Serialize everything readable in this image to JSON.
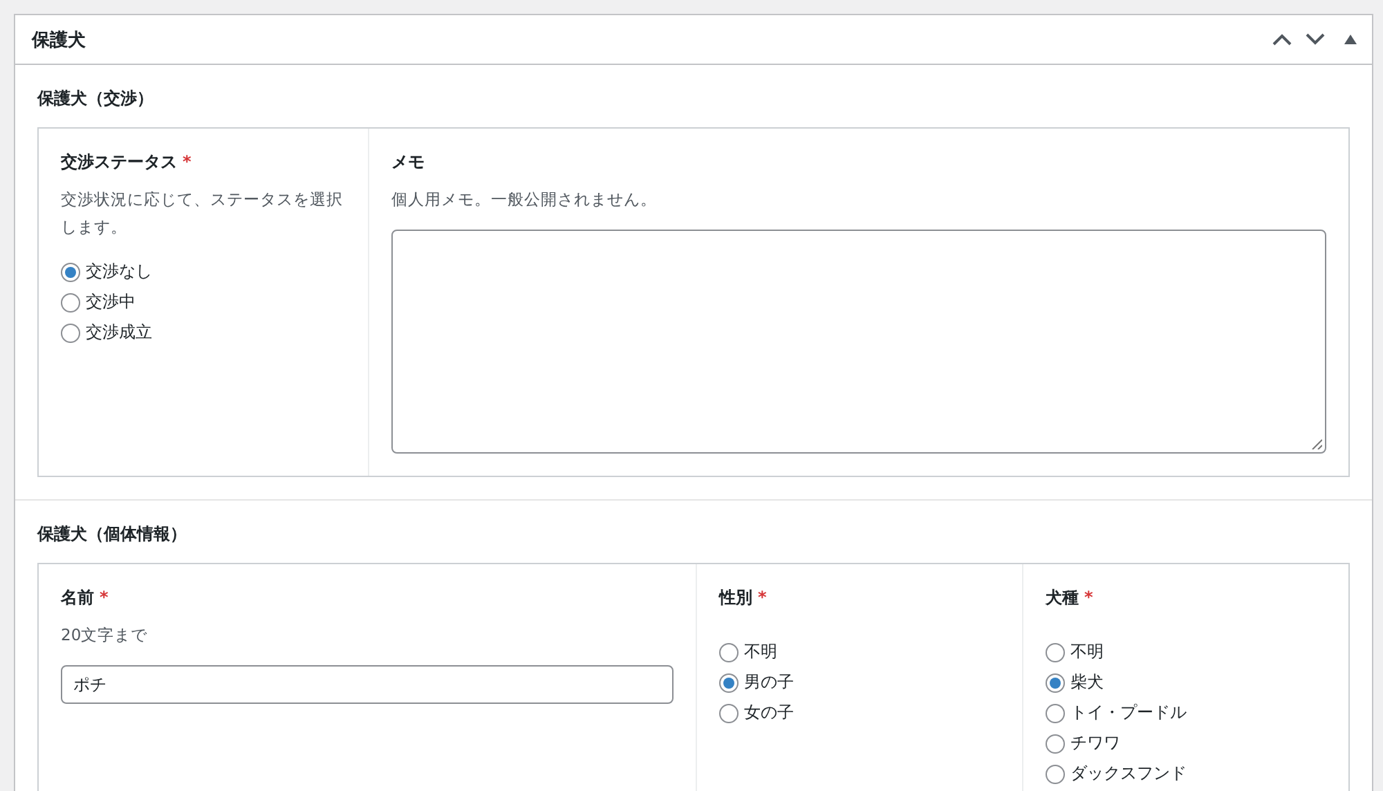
{
  "panel": {
    "title": "保護犬",
    "controls": [
      {
        "kind": "up"
      },
      {
        "kind": "down"
      },
      {
        "kind": "toggle"
      }
    ]
  },
  "sections": [
    {
      "title": "保護犬（交渉）",
      "fields": [
        {
          "kind": "radio",
          "label": "交渉ステータス",
          "required_mark": "*",
          "description": "交渉状況に応じて、ステータスを選択します。",
          "options": [
            {
              "label": "交渉なし",
              "selected": true
            },
            {
              "label": "交渉中",
              "selected": false
            },
            {
              "label": "交渉成立",
              "selected": false
            }
          ]
        },
        {
          "kind": "textarea",
          "label": "メモ",
          "description": "個人用メモ。一般公開されません。"
        }
      ]
    },
    {
      "title": "保護犬（個体情報）",
      "fields": [
        {
          "kind": "text",
          "label": "名前",
          "required_mark": "*",
          "description": "20文字まで",
          "value": "ポチ"
        },
        {
          "kind": "radio",
          "label": "性別",
          "required_mark": "*",
          "options": [
            {
              "label": "不明",
              "selected": false
            },
            {
              "label": "男の子",
              "selected": true
            },
            {
              "label": "女の子",
              "selected": false
            }
          ]
        },
        {
          "kind": "radio",
          "label": "犬種",
          "required_mark": "*",
          "options": [
            {
              "label": "不明",
              "selected": false
            },
            {
              "label": "柴犬",
              "selected": true
            },
            {
              "label": "トイ・プードル",
              "selected": false
            },
            {
              "label": "チワワ",
              "selected": false
            },
            {
              "label": "ダックスフンド",
              "selected": false
            }
          ]
        }
      ]
    }
  ]
}
